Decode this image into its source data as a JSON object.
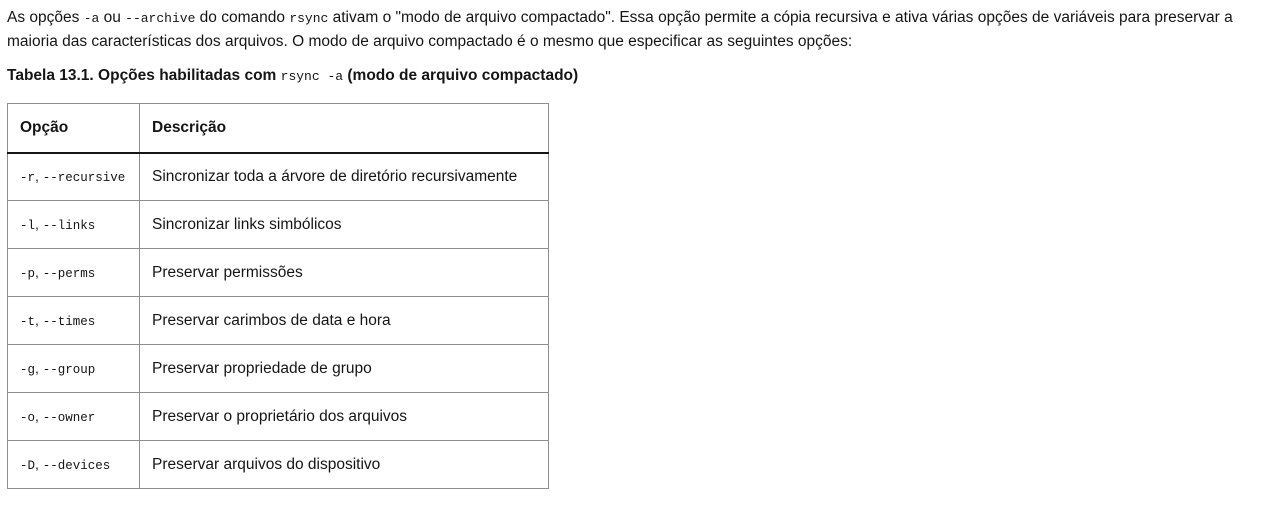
{
  "intro": {
    "t1": "As opções ",
    "c1": "-a",
    "t2": " ou ",
    "c2": "--archive",
    "t3": " do comando ",
    "c3": "rsync",
    "t4": " ativam o \"modo de arquivo compactado\". Essa opção permite a cópia recursiva e ativa várias opções de variáveis para preservar a maioria das características dos arquivos. O modo de arquivo compactado é o mesmo que especificar as seguintes opções:"
  },
  "table_title": {
    "prefix": "Tabela 13.1. Opções habilitadas com ",
    "code": "rsync -a",
    "suffix": " (modo de arquivo compactado)"
  },
  "table": {
    "headers": {
      "option": "Opção",
      "description": "Descrição"
    },
    "rows": [
      {
        "short": "-r",
        "sep": ", ",
        "long": "--recursive",
        "desc": "Sincronizar toda a árvore de diretório recursivamente"
      },
      {
        "short": "-l",
        "sep": ", ",
        "long": "--links",
        "desc": "Sincronizar links simbólicos"
      },
      {
        "short": "-p",
        "sep": ", ",
        "long": "--perms",
        "desc": "Preservar permissões"
      },
      {
        "short": "-t",
        "sep": ", ",
        "long": "--times",
        "desc": "Preservar carimbos de data e hora"
      },
      {
        "short": "-g",
        "sep": ", ",
        "long": "--group",
        "desc": "Preservar propriedade de grupo"
      },
      {
        "short": "-o",
        "sep": ", ",
        "long": "--owner",
        "desc": "Preservar o proprietário dos arquivos"
      },
      {
        "short": "-D",
        "sep": ", ",
        "long": "--devices",
        "desc": "Preservar arquivos do dispositivo"
      }
    ]
  }
}
